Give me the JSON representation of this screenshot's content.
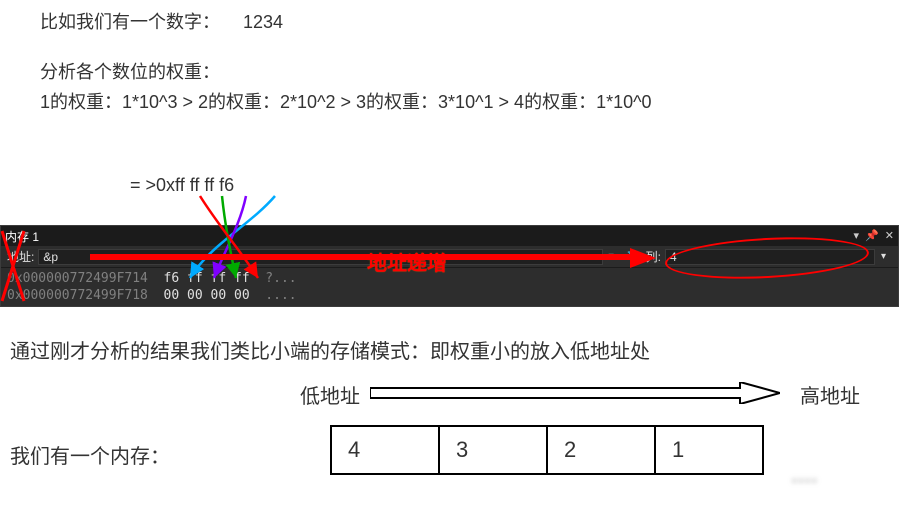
{
  "intro": {
    "line1_prefix": "比如我们有一个数字：",
    "line1_number": "1234",
    "line2": "分析各个数位的权重：",
    "line3": "1的权重：1*10^3 > 2的权重：2*10^2 > 3的权重：3*10^1 > 4的权重：1*10^0",
    "hex_label": "= >0xff ff ff f6"
  },
  "memory_panel": {
    "title": "内存 1",
    "addr_label": "地址:",
    "addr_value": "&p",
    "col_label": "列:",
    "col_value": "4",
    "rows": [
      {
        "addr": "0x000000772499F714",
        "hex": "f6 ff ff ff",
        "ascii": "?..."
      },
      {
        "addr": "0x000000772499F718",
        "hex": "00 00 00 00",
        "ascii": "...."
      }
    ],
    "addr_grow_text": "地址递增"
  },
  "conclusion_text": "通过刚才分析的结果我们类比小端的存储模式：即权重小的放入低地址处",
  "diagram": {
    "low_label": "低地址",
    "high_label": "高地址",
    "we_have_mem": "我们有一个内存：",
    "boxes": [
      "4",
      "3",
      "2",
      "1"
    ]
  },
  "icons": {
    "dropdown": "dropdown-caret-icon",
    "pin": "pin-icon",
    "close": "close-icon",
    "refresh": "refresh-icon"
  }
}
